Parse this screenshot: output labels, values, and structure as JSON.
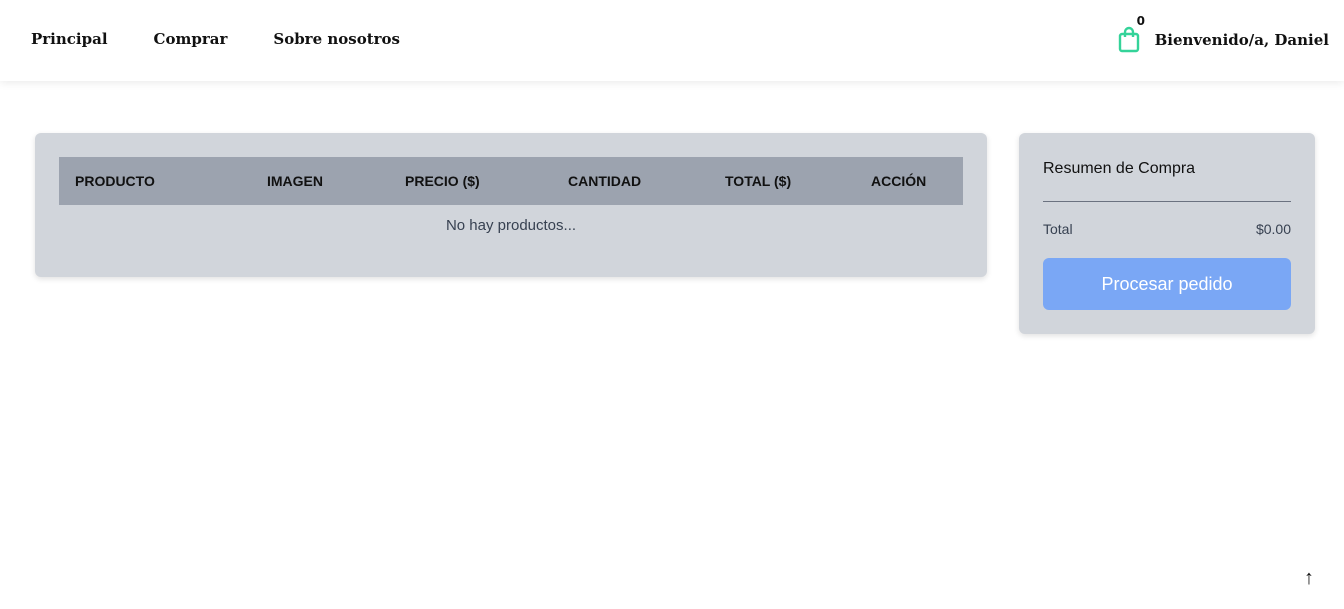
{
  "nav": {
    "links": [
      "Principal",
      "Comprar",
      "Sobre nosotros"
    ],
    "cart_count": "0",
    "cart_icon": "shopping-bag-icon",
    "cart_color": "#34d399",
    "welcome": "Bienvenido/a, Daniel"
  },
  "cart_table": {
    "headers": [
      "PRODUCTO",
      "IMAGEN",
      "PRECIO ($)",
      "CANTIDAD",
      "TOTAL ($)",
      "ACCIÓN"
    ],
    "rows": [],
    "empty_message": "No hay productos..."
  },
  "summary": {
    "title": "Resumen de Compra",
    "total_label": "Total",
    "total_value": "$0.00",
    "button_label": "Procesar pedido"
  },
  "scroll_top": {
    "icon": "arrow-up-icon",
    "glyph": "↑"
  },
  "colors": {
    "panel": "#d1d5db",
    "table_header": "#9ca3af",
    "primary_button": "#7aa7f5"
  }
}
